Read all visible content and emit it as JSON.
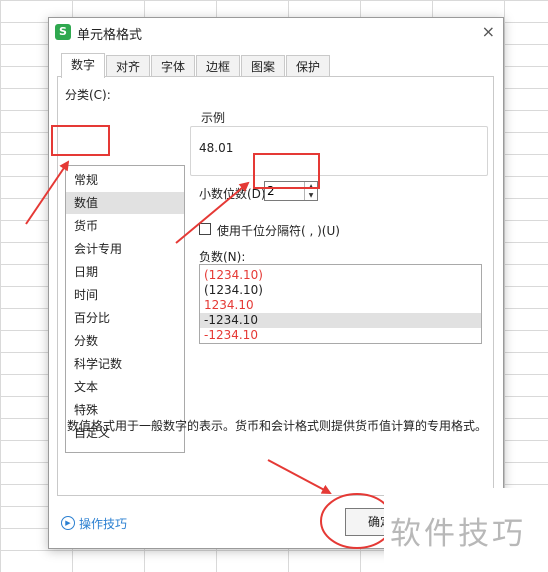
{
  "dialog": {
    "title": "单元格格式",
    "icon_label": "S",
    "close_glyph": "×"
  },
  "tabs": [
    {
      "label": "数字",
      "active": true
    },
    {
      "label": "对齐",
      "active": false
    },
    {
      "label": "字体",
      "active": false
    },
    {
      "label": "边框",
      "active": false
    },
    {
      "label": "图案",
      "active": false
    },
    {
      "label": "保护",
      "active": false
    }
  ],
  "category": {
    "label": "分类(C):",
    "selected": "数值",
    "items": [
      "常规",
      "数值",
      "货币",
      "会计专用",
      "日期",
      "时间",
      "百分比",
      "分数",
      "科学记数",
      "文本",
      "特殊",
      "自定义"
    ]
  },
  "sample": {
    "label": "示例",
    "value": "48.01"
  },
  "decimal_places": {
    "label": "小数位数(D):",
    "value": "2",
    "up_glyph": "▲",
    "down_glyph": "▼"
  },
  "thousand_separator": {
    "label": "使用千位分隔符( , )(U)",
    "checked": false
  },
  "negative_numbers": {
    "label": "负数(N):",
    "selected_index": 3,
    "items": [
      {
        "text": "(1234.10)",
        "color": "#e53935"
      },
      {
        "text": "(1234.10)",
        "color": "#222222"
      },
      {
        "text": "1234.10",
        "color": "#e53935"
      },
      {
        "text": "-1234.10",
        "color": "#222222"
      },
      {
        "text": "-1234.10",
        "color": "#e53935"
      }
    ]
  },
  "description": "数值格式用于一般数字的表示。货币和会计格式则提供货币值计算的专用格式。",
  "help_link": {
    "label": "操作技巧",
    "icon": "play-circle-icon"
  },
  "ok_button": {
    "label": "确定"
  },
  "watermark": "软件技巧",
  "colors": {
    "annotation_red": "#e53935",
    "link_blue": "#2a7fd1",
    "brand_green": "#2fa84f"
  }
}
